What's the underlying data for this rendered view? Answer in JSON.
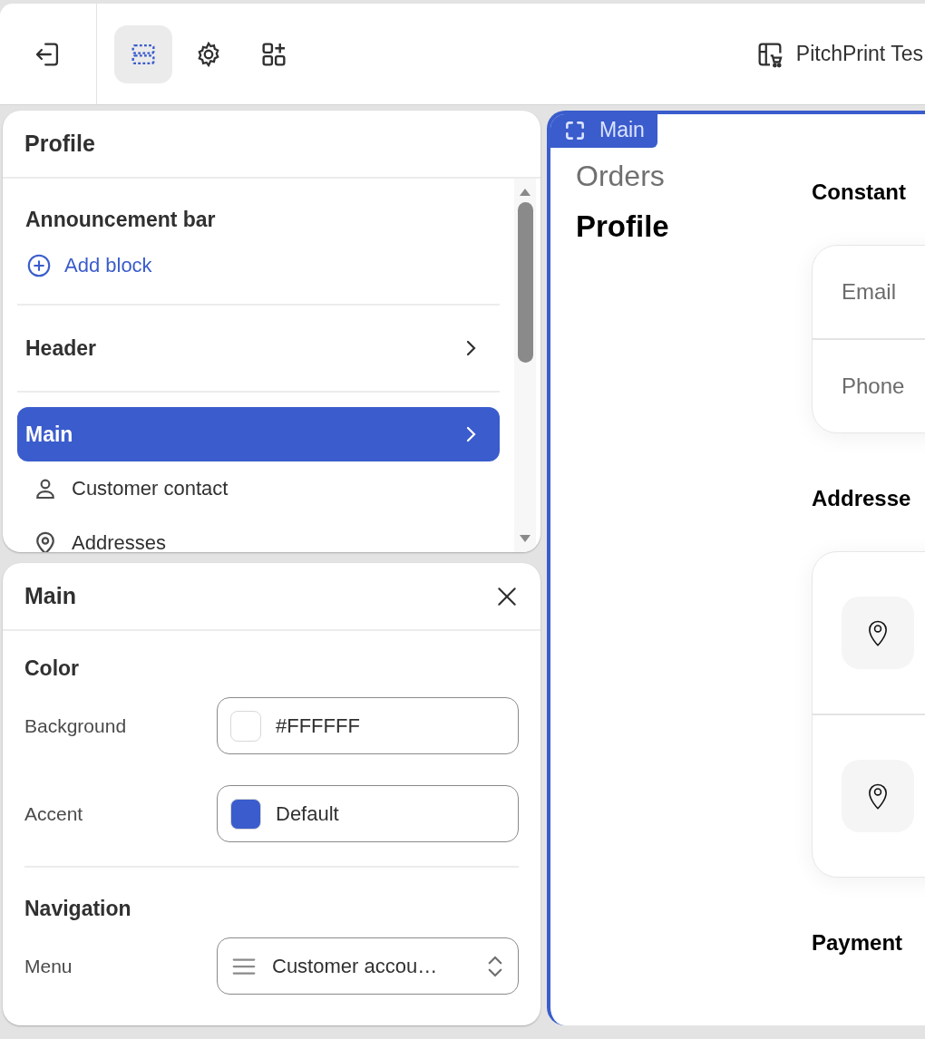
{
  "toolbar": {
    "exit": {
      "selected": false
    },
    "tools": [
      {
        "kind": "sections",
        "selected": true
      },
      {
        "kind": "settings",
        "selected": false
      },
      {
        "kind": "apps",
        "selected": false
      }
    ],
    "store_name": "PitchPrint Tes"
  },
  "sections_panel": {
    "title": "Profile",
    "items": [
      {
        "kind": "group",
        "title": "Announcement bar",
        "selected": false,
        "action": "Add block"
      },
      {
        "kind": "item",
        "title": "Header",
        "selected": false
      },
      {
        "kind": "item",
        "title": "Main",
        "selected": true,
        "children": [
          {
            "kind": "person",
            "label": "Customer contact"
          },
          {
            "kind": "pin",
            "label": "Addresses"
          }
        ]
      }
    ]
  },
  "settings_panel": {
    "title": "Main",
    "sections": [
      {
        "heading": "Color",
        "fields": [
          {
            "kind": "color",
            "label": "Background",
            "color": "#ffffff",
            "value": "#FFFFFF"
          },
          {
            "kind": "color",
            "label": "Accent",
            "color": "#3a5ccc",
            "value": "Default"
          }
        ]
      },
      {
        "heading": "Navigation",
        "fields": [
          {
            "kind": "select",
            "label": "Menu",
            "value": "Customer accou…"
          }
        ]
      }
    ]
  },
  "preview": {
    "tag": "Main",
    "nav": [
      {
        "label": "Orders",
        "selected": false
      },
      {
        "label": "Profile",
        "selected": true
      }
    ],
    "sections": [
      {
        "heading": "Constant",
        "card": {
          "kind": "fields",
          "rows": [
            "Email",
            "Phone"
          ]
        }
      },
      {
        "heading": "Addresse",
        "card": {
          "kind": "addresses",
          "rows": [
            {
              "kind": "address"
            },
            {
              "kind": "address"
            }
          ]
        }
      },
      {
        "heading": "Payment"
      }
    ]
  }
}
